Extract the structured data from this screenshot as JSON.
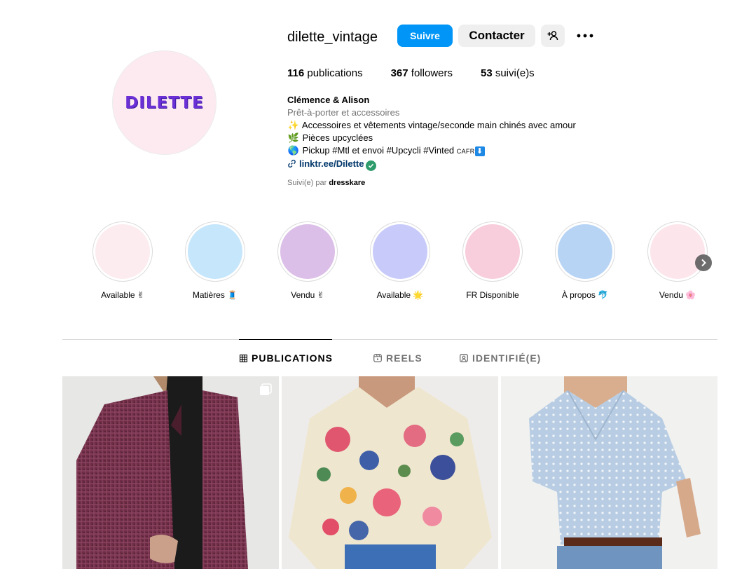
{
  "profile": {
    "avatar_text": "DILETTE",
    "username": "dilette_vintage",
    "follow_label": "Suivre",
    "contact_label": "Contacter",
    "stats": {
      "posts_count": "116",
      "posts_label": "publications",
      "followers_count": "367",
      "followers_label": "followers",
      "following_count": "53",
      "following_label": "suivi(e)s"
    },
    "bio": {
      "name": "Clémence & Alison",
      "category": "Prêt-à-porter et accessoires",
      "line1_emoji": "✨",
      "line1": "Accessoires et vêtements vintage/seconde main chinés avec amour",
      "line2_emoji": "🌿",
      "line2": "Pièces upcyclées",
      "line3_emoji": "🌎",
      "line3": "Pickup #Mtl et envoi #Upcycli #Vinted",
      "line3_suffix": "CAFR",
      "line3_end_emoji": "⬇",
      "link": "linktr.ee/Dilette"
    },
    "followed_by_prefix": "Suivi(e) par",
    "followed_by_user": "dresskare"
  },
  "highlights": [
    {
      "label": "Available ✌",
      "color": "#fcecef"
    },
    {
      "label": "Matières 🧵",
      "color": "#c5e6fb"
    },
    {
      "label": "Vendu ✌",
      "color": "#dcbfe8"
    },
    {
      "label": "Available 🌟",
      "color": "#c8cbfa"
    },
    {
      "label": "FR Disponible",
      "color": "#f8cddc"
    },
    {
      "label": "À propos 🐬",
      "color": "#b7d4f5"
    },
    {
      "label": "Vendu 🌸",
      "color": "#fce6ec"
    }
  ],
  "tabs": [
    {
      "label": "PUBLICATIONS",
      "active": true
    },
    {
      "label": "REELS",
      "active": false
    },
    {
      "label": "IDENTIFIÉ(E)",
      "active": false
    }
  ],
  "colors": {
    "accent": "#0095f6",
    "secondary_button": "#efefef",
    "link": "#00376b"
  },
  "icons": [
    "add-person-icon",
    "more-options-icon",
    "link-icon",
    "verified-icon",
    "chevron-right-icon",
    "grid-icon",
    "reels-icon",
    "tagged-icon",
    "multiple-posts-icon"
  ]
}
